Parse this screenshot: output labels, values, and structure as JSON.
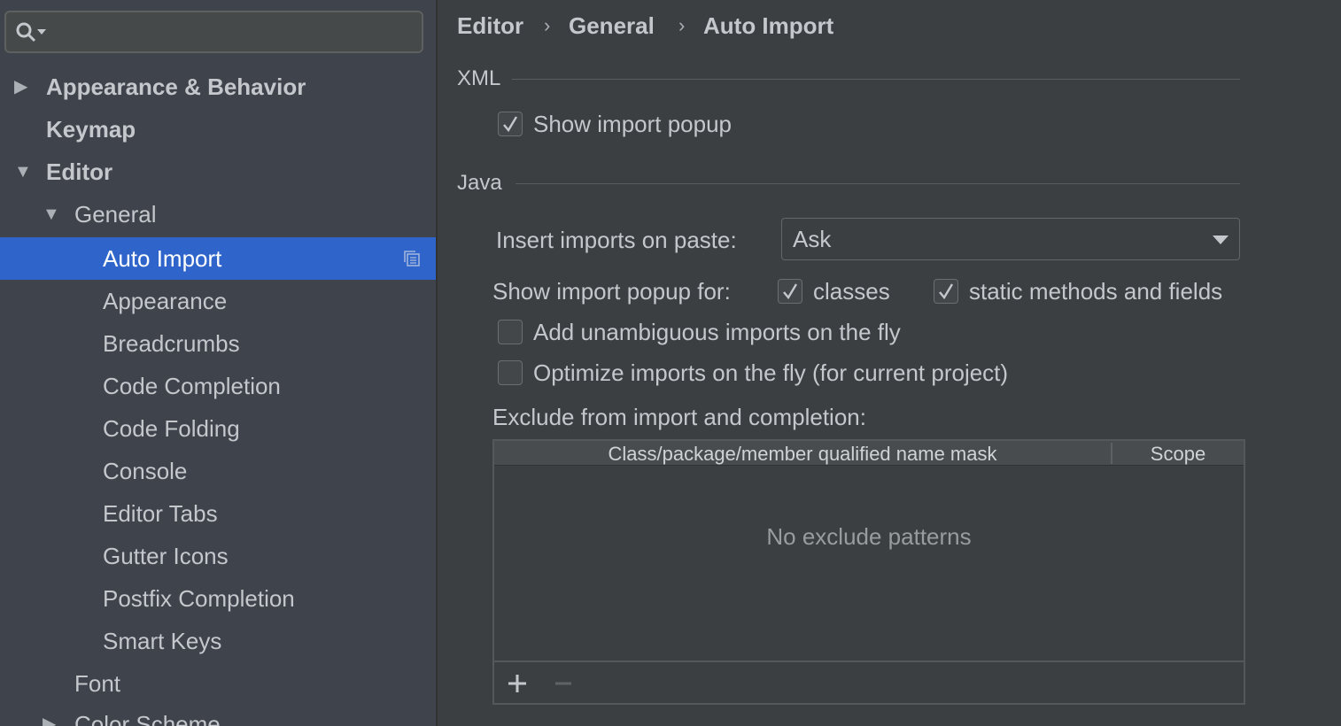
{
  "sidebar": {
    "search": {
      "value": "",
      "icon": "search-icon"
    },
    "items": [
      {
        "label": "Appearance & Behavior",
        "arrow": "▶",
        "bold": true
      },
      {
        "label": "Keymap",
        "arrow": "",
        "bold": true
      },
      {
        "label": "Editor",
        "arrow": "▼",
        "bold": true
      },
      {
        "label": "General",
        "arrow": "▼",
        "bold": false
      },
      {
        "label": "Auto Import",
        "arrow": "",
        "bold": false,
        "selected": true
      },
      {
        "label": "Appearance",
        "arrow": "",
        "bold": false
      },
      {
        "label": "Breadcrumbs",
        "arrow": "",
        "bold": false
      },
      {
        "label": "Code Completion",
        "arrow": "",
        "bold": false
      },
      {
        "label": "Code Folding",
        "arrow": "",
        "bold": false
      },
      {
        "label": "Console",
        "arrow": "",
        "bold": false
      },
      {
        "label": "Editor Tabs",
        "arrow": "",
        "bold": false
      },
      {
        "label": "Gutter Icons",
        "arrow": "",
        "bold": false
      },
      {
        "label": "Postfix Completion",
        "arrow": "",
        "bold": false
      },
      {
        "label": "Smart Keys",
        "arrow": "",
        "bold": false
      },
      {
        "label": "Font",
        "arrow": "",
        "bold": false
      },
      {
        "label": "Color Scheme",
        "arrow": "▶",
        "bold": false
      }
    ]
  },
  "breadcrumb": {
    "items": [
      "Editor",
      "General",
      "Auto Import"
    ],
    "separator": "›"
  },
  "xml": {
    "title": "XML",
    "show_import_popup": {
      "label": "Show import popup",
      "checked": true
    }
  },
  "java": {
    "title": "Java",
    "insert_imports_label": "Insert imports on paste:",
    "insert_imports_value": "Ask",
    "show_popup_for_label": "Show import popup for:",
    "classes": {
      "label": "classes",
      "checked": true
    },
    "static_methods": {
      "label": "static methods and fields",
      "checked": true
    },
    "add_unambiguous": {
      "label": "Add unambiguous imports on the fly",
      "checked": false
    },
    "optimize_imports": {
      "label": "Optimize imports on the fly (for current project)",
      "checked": false
    },
    "exclude_label": "Exclude from import and completion:",
    "table": {
      "columns": [
        "Class/package/member qualified name mask",
        "Scope"
      ],
      "empty_text": "No exclude patterns",
      "add_button": "+",
      "remove_button": "−"
    }
  },
  "colors": {
    "selection": "#2f65ca",
    "sidebar_bg": "#3e434c",
    "main_bg": "#3c3f41"
  }
}
